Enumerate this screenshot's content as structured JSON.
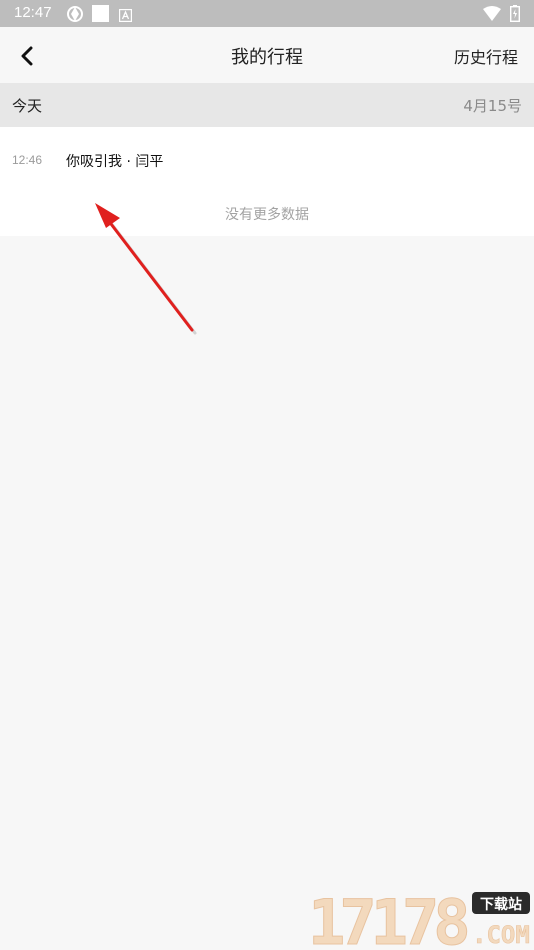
{
  "status_bar": {
    "time": "12:47",
    "icons": [
      "sync-icon",
      "square-app-icon",
      "notification-a-icon",
      "wifi-icon",
      "battery-icon"
    ]
  },
  "nav": {
    "title": "我的行程",
    "history_label": "历史行程",
    "back_icon": "chevron-left-icon"
  },
  "day_group": {
    "label": "今天",
    "date": "4月15号"
  },
  "trips": [
    {
      "time": "12:46",
      "title": "你吸引我 · 闫平"
    }
  ],
  "list_footer": "没有更多数据",
  "annotation": {
    "color": "#e0201e"
  },
  "watermark": {
    "digits": "17178",
    "badge": "下载站",
    "domain": ".COM"
  },
  "colors": {
    "status_bar_bg": "#bdbdbd",
    "page_bg": "#f7f7f7",
    "day_header_bg": "#e7e7e7",
    "muted_text": "#9b9b9b"
  }
}
